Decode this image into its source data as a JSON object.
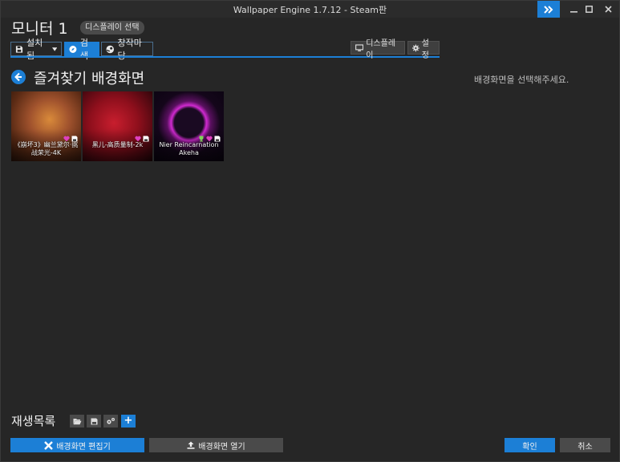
{
  "window": {
    "title": "Wallpaper Engine 1.7.12 - Steam판"
  },
  "header": {
    "monitor_title": "모니터 1",
    "display_select": "디스플레이 선택"
  },
  "tabs": [
    {
      "label": "설치됨"
    },
    {
      "label": "검색"
    },
    {
      "label": "창작마당"
    }
  ],
  "toolbar": {
    "display_label": "디스플레이",
    "settings_label": "설정"
  },
  "main": {
    "heading": "즐겨찾기 배경화면",
    "hint": "배경화면을 선택해주세요."
  },
  "wallpapers": [
    {
      "title": "《崩坏3》幽兰黛尔·挑战荣光-4K"
    },
    {
      "title": "黑儿-高质量制-2k"
    },
    {
      "title": "Nier Reincarnation Akeha"
    }
  ],
  "playlist": {
    "title": "재생목록",
    "add_label": "+"
  },
  "buttons": {
    "editor": "배경화면 편집기",
    "open": "배경화면 열기",
    "ok": "확인",
    "cancel": "취소"
  },
  "colors": {
    "accent": "#1c7fd6",
    "background": "#262626",
    "favorite": "#e040c0"
  }
}
